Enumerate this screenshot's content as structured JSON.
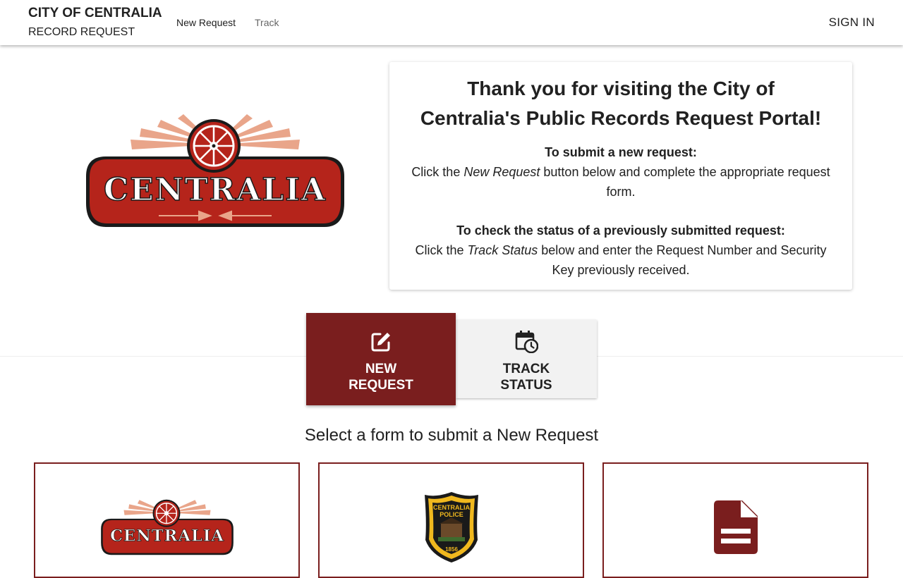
{
  "header": {
    "title": "CITY OF CENTRALIA",
    "subtitle": "RECORD REQUEST",
    "nav": {
      "new_request": "New Request",
      "track": "Track"
    },
    "sign_in": "SIGN IN"
  },
  "logo": {
    "text": "CENTRALIA"
  },
  "welcome": {
    "heading": "Thank you for visiting the City of Centralia's Public Records Request Portal!",
    "submit": {
      "title": "To submit a new request:",
      "prefix": "Click the ",
      "emphasis": "New Request",
      "suffix": " button below and complete the appropriate request form."
    },
    "check": {
      "title": "To check the status of a previously submitted request:",
      "prefix": "Click the ",
      "emphasis": "Track Status",
      "suffix": " below and enter the Request Number and Security Key previously received."
    }
  },
  "actions": {
    "new_request": {
      "label": "NEW REQUEST",
      "icon": "edit-square-icon"
    },
    "track_status": {
      "label": "TRACK STATUS",
      "icon": "calendar-clock-icon"
    }
  },
  "forms": {
    "heading": "Select a form to submit a New Request",
    "cards": [
      {
        "icon": "centralia-logo"
      },
      {
        "icon": "centralia-police-badge",
        "badge_text": "CENTRALIA POLICE",
        "badge_year": "1856"
      },
      {
        "icon": "document-icon"
      }
    ]
  },
  "colors": {
    "accent": "#7a1e1e",
    "logo_red": "#b5241b",
    "logo_rays": "#e9a58a"
  }
}
